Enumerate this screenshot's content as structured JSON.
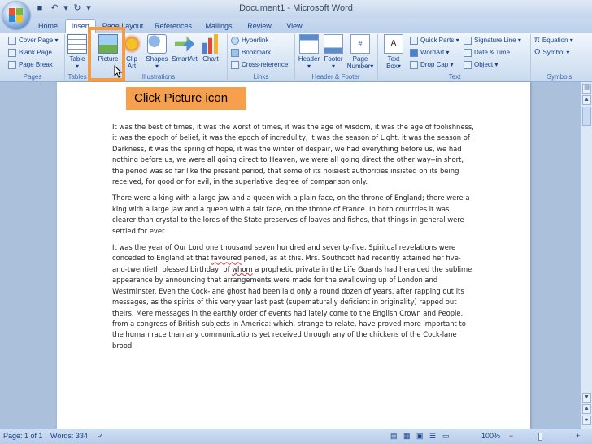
{
  "app": {
    "title": "Document1 - Microsoft Word"
  },
  "tabs": [
    "Home",
    "Insert",
    "Page Layout",
    "References",
    "Mailings",
    "Review",
    "View"
  ],
  "ribbon": {
    "pages": {
      "label": "Pages",
      "cover_page": "Cover Page",
      "blank_page": "Blank Page",
      "page_break": "Page Break"
    },
    "tables": {
      "label": "Tables",
      "table": "Table"
    },
    "illustrations": {
      "label": "Illustrations",
      "picture": "Picture",
      "clip_art_1": "Clip",
      "clip_art_2": "Art",
      "shapes": "Shapes",
      "smartart": "SmartArt",
      "chart": "Chart"
    },
    "links": {
      "label": "Links",
      "hyperlink": "Hyperlink",
      "bookmark": "Bookmark",
      "cross_reference": "Cross-reference"
    },
    "header_footer": {
      "label": "Header & Footer",
      "header": "Header",
      "footer": "Footer",
      "page_number_1": "Page",
      "page_number_2": "Number"
    },
    "text": {
      "label": "Text",
      "text_box_1": "Text",
      "text_box_2": "Box",
      "quick_parts": "Quick Parts",
      "wordart": "WordArt",
      "drop_cap": "Drop Cap",
      "signature_line": "Signature Line",
      "date_time": "Date & Time",
      "object": "Object"
    },
    "symbols": {
      "label": "Symbols",
      "equation": "Equation",
      "symbol": "Symbol"
    }
  },
  "tooltip": "Click Picture icon",
  "document": {
    "paragraphs": [
      "It was the best of times, it was the worst of times, it was the age of wisdom, it was the age of foolishness, it was the epoch of belief, it was the epoch of incredulity, it was the season of Light, it was the season of Darkness, it was the spring of hope, it was the winter of despair, we had everything before us, we had nothing before us, we were all going direct to Heaven, we were all going direct the other way--in short, the period was so far like the present period, that some of its noisiest authorities insisted on its being received, for good or for evil, in the superlative degree of comparison only.",
      "There were a king with a large jaw and a queen with a plain face, on the throne of England; there were a king with a large jaw and a queen with a fair face, on the throne of France. In both countries it was clearer than crystal to the lords of the State preserves of loaves and fishes, that things in general were settled for ever."
    ],
    "para3": {
      "a": "It was the year of Our Lord one thousand seven hundred and seventy-five. Spiritual revelations were conceded to England at that ",
      "favoured": "favoured",
      "b": " period, as at this. Mrs. Southcott had recently attained her five-and-twentieth blessed birthday, of ",
      "whom": "whom",
      "c": " a prophetic private in the Life Guards had heralded the sublime appearance by announcing that arrangements were made for the swallowing up of London and Westminster. Even the Cock-lane ghost had been laid only a round dozen of years, after rapping out its messages, as the spirits of this very year last past (supernaturally deficient in originality) rapped out theirs. Mere messages in the earthly order of events had lately come to the English Crown and People, from a congress of British subjects in America:  which, strange to relate, have proved more important to the human race than any communications yet received through any of the chickens of the Cock-lane brood."
    }
  },
  "status": {
    "page": "Page: 1 of 1",
    "words": "Words: 334",
    "zoom": "100%"
  },
  "colors": {
    "highlight": "#f59b43",
    "tooltip_bg": "#f6a04d",
    "ribbon_text": "#15428b"
  }
}
